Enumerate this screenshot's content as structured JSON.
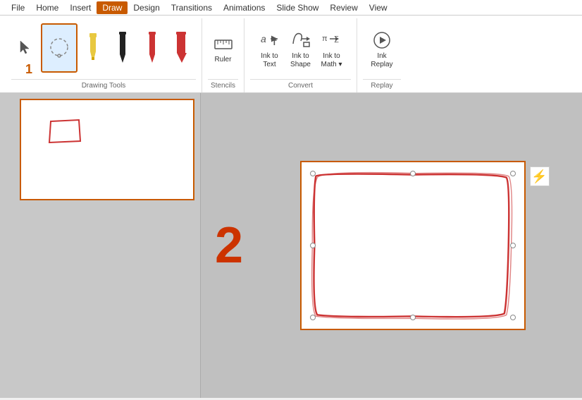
{
  "menu": {
    "items": [
      {
        "label": "File",
        "active": false
      },
      {
        "label": "Home",
        "active": false
      },
      {
        "label": "Insert",
        "active": false
      },
      {
        "label": "Draw",
        "active": true
      },
      {
        "label": "Design",
        "active": false
      },
      {
        "label": "Transitions",
        "active": false
      },
      {
        "label": "Animations",
        "active": false
      },
      {
        "label": "Slide Show",
        "active": false
      },
      {
        "label": "Review",
        "active": false
      },
      {
        "label": "View",
        "active": false
      }
    ]
  },
  "ribbon": {
    "groups": [
      {
        "id": "drawing-tools",
        "label": "Drawing Tools"
      },
      {
        "id": "stencils",
        "label": "Stencils"
      },
      {
        "id": "convert",
        "label": "Convert",
        "buttons": [
          {
            "id": "ink-to-text",
            "line1": "Ink to",
            "line2": "Text"
          },
          {
            "id": "ink-to-shape",
            "line1": "Ink to",
            "line2": "Shape"
          },
          {
            "id": "ink-to-math",
            "line1": "Ink to",
            "line2": "Math ▾"
          }
        ]
      },
      {
        "id": "replay",
        "label": "Replay",
        "buttons": [
          {
            "id": "ink-replay",
            "line1": "Ink",
            "line2": "Replay"
          }
        ]
      }
    ],
    "ruler_label": "Ruler",
    "convert_label": "Convert",
    "replay_label": "Replay"
  },
  "slides": [
    {
      "number": "1"
    },
    {
      "number": "2"
    }
  ],
  "canvas": {
    "slide_number": "2"
  }
}
